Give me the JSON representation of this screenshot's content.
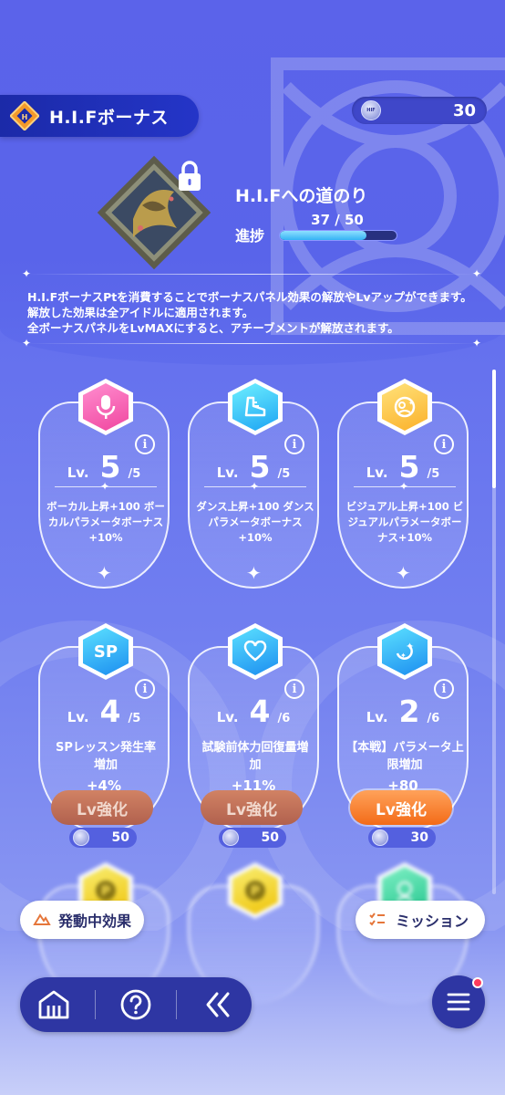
{
  "header": {
    "title": "H.I.Fボーナス",
    "currency_value": "30"
  },
  "road": {
    "title": "H.I.Fへの道のり",
    "progress_label": "進捗",
    "progress_text": "37 / 50",
    "progress_fraction": 0.74
  },
  "description": [
    "H.I.FボーナスPtを消費することでボーナスパネル効果の解放やLvアップができます。解放した効果は全アイドルに適用されます。",
    "全ボーナスパネルをLvMAXにすると、アチーブメントが解放されます。"
  ],
  "panels": [
    {
      "icon": "microphone-icon",
      "lv_label": "Lv.",
      "level": "5",
      "max": "/5",
      "desc": "ボーカル上昇+100 ボーカルパラメータボーナス+10%"
    },
    {
      "icon": "dance-shoe-icon",
      "lv_label": "Lv.",
      "level": "5",
      "max": "/5",
      "desc": "ダンス上昇+100 ダンスパラメータボーナス+10%"
    },
    {
      "icon": "visual-face-icon",
      "lv_label": "Lv.",
      "level": "5",
      "max": "/5",
      "desc": "ビジュアル上昇+100 ビジュアルパラメータボーナス+10%"
    },
    {
      "icon": "sp-icon",
      "icon_text": "SP",
      "lv_label": "Lv.",
      "level": "4",
      "max": "/5",
      "desc": "SPレッスン発生率増加",
      "value": "+4%",
      "button": "Lv強化",
      "cost": "50"
    },
    {
      "icon": "heart-icon",
      "lv_label": "Lv.",
      "level": "4",
      "max": "/6",
      "desc": "試験前体力回復量増加",
      "value": "+11%",
      "button": "Lv強化",
      "cost": "50"
    },
    {
      "icon": "parameter-sparkle-icon",
      "lv_label": "Lv.",
      "level": "2",
      "max": "/6",
      "desc": "【本戦】パラメータ上限増加",
      "value": "+80",
      "button": "Lv強化",
      "cost": "30"
    }
  ],
  "bottom": {
    "active_effects": "発動中効果",
    "mission": "ミッション"
  },
  "colors": {
    "accent_orange": "#f36b18",
    "background": "#5b63ea",
    "header_dark": "#1b2aa8"
  }
}
